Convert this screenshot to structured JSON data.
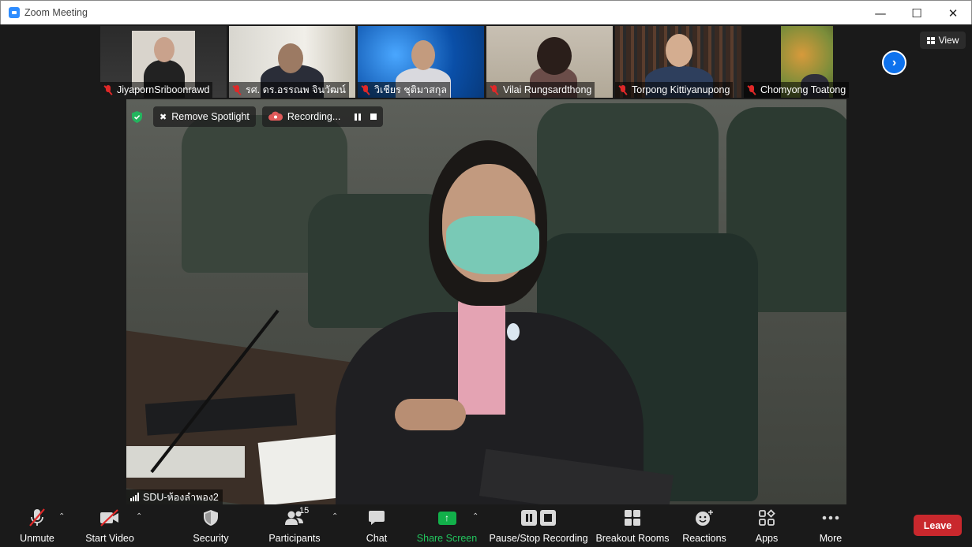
{
  "window": {
    "title": "Zoom Meeting",
    "controls": {
      "minimize": "—",
      "maximize": "☐",
      "close": "✕"
    }
  },
  "view_button": {
    "label": "View"
  },
  "participants_strip": [
    {
      "name": "JiyapornSriboonrawd",
      "muted": true
    },
    {
      "name": "รศ. ดร.อรรณพ จินวัฒน์",
      "muted": true
    },
    {
      "name": "วิเชียร ชุติมาสกุล",
      "muted": true
    },
    {
      "name": "Vilai Rungsardthong",
      "muted": true
    },
    {
      "name": "Torpong Kittiyanupong",
      "muted": true
    },
    {
      "name": "Chomyong Toatong",
      "muted": true
    }
  ],
  "spotlight": {
    "remove_label": "Remove Spotlight",
    "recording_label": "Recording..."
  },
  "main_speaker": {
    "name": "SDU-ห้องลำพอง2"
  },
  "toolbar": {
    "unmute": "Unmute",
    "start_video": "Start Video",
    "security": "Security",
    "participants": "Participants",
    "participants_count": "15",
    "chat": "Chat",
    "share_screen": "Share Screen",
    "pause_stop_recording": "Pause/Stop Recording",
    "breakout_rooms": "Breakout Rooms",
    "reactions": "Reactions",
    "apps": "Apps",
    "more": "More",
    "leave": "Leave"
  },
  "colors": {
    "accent_blue": "#0e72ed",
    "muted_red": "#e02828",
    "share_green": "#12b04a",
    "leave_red": "#c9282d"
  }
}
